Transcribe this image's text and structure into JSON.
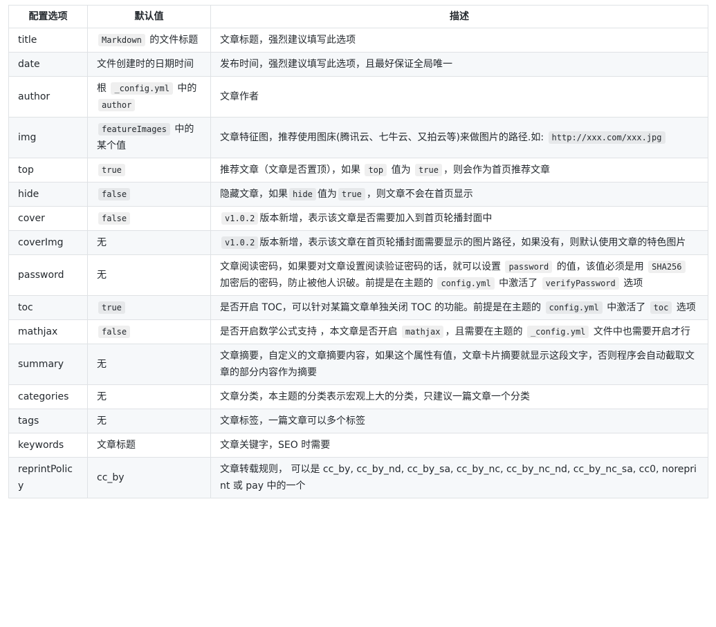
{
  "headers": [
    "配置选项",
    "默认值",
    "描述"
  ],
  "rows": [
    {
      "name": "title",
      "default": [
        {
          "code": "Markdown"
        },
        " 的文件标题"
      ],
      "desc": [
        "文章标题，强烈建议填写此选项"
      ]
    },
    {
      "name": "date",
      "default": [
        "文件创建时的日期时间"
      ],
      "desc": [
        "发布时间，强烈建议填写此选项，且最好保证全局唯一"
      ]
    },
    {
      "name": "author",
      "default": [
        "根 ",
        {
          "code": "_config.yml"
        },
        " 中的 ",
        {
          "code": "author"
        }
      ],
      "desc": [
        "文章作者"
      ]
    },
    {
      "name": "img",
      "default": [
        {
          "code": "featureImages"
        },
        " 中的某个值"
      ],
      "desc": [
        "文章特征图，推荐使用图床(腾讯云、七牛云、又拍云等)来做图片的路径.如: ",
        {
          "code": "http://xxx.com/xxx.jpg"
        }
      ]
    },
    {
      "name": "top",
      "default": [
        {
          "code": "true"
        }
      ],
      "desc": [
        "推荐文章（文章是否置顶），如果 ",
        {
          "code": "top"
        },
        " 值为 ",
        {
          "code": "true"
        },
        "，则会作为首页推荐文章"
      ]
    },
    {
      "name": "hide",
      "default": [
        {
          "code": "false"
        }
      ],
      "desc": [
        "隐藏文章，如果",
        {
          "code": "hide"
        },
        "值为",
        {
          "code": "true"
        },
        "，则文章不会在首页显示"
      ]
    },
    {
      "name": "cover",
      "default": [
        {
          "code": "false"
        }
      ],
      "desc": [
        {
          "code": "v1.0.2"
        },
        "版本新增，表示该文章是否需要加入到首页轮播封面中"
      ]
    },
    {
      "name": "coverImg",
      "default": [
        "无"
      ],
      "desc": [
        {
          "code": "v1.0.2"
        },
        "版本新增，表示该文章在首页轮播封面需要显示的图片路径，如果没有，则默认使用文章的特色图片"
      ]
    },
    {
      "name": "password",
      "default": [
        "无"
      ],
      "desc": [
        "文章阅读密码，如果要对文章设置阅读验证密码的话，就可以设置 ",
        {
          "code": "password"
        },
        " 的值，该值必须是用 ",
        {
          "code": "SHA256"
        },
        " 加密后的密码，防止被他人识破。前提是在主题的 ",
        {
          "code": "config.yml"
        },
        " 中激活了 ",
        {
          "code": "verifyPassword"
        },
        " 选项"
      ]
    },
    {
      "name": "toc",
      "default": [
        {
          "code": "true"
        }
      ],
      "desc": [
        "是否开启 TOC，可以针对某篇文章单独关闭 TOC 的功能。前提是在主题的 ",
        {
          "code": "config.yml"
        },
        " 中激活了 ",
        {
          "code": "toc"
        },
        " 选项"
      ]
    },
    {
      "name": "mathjax",
      "default": [
        {
          "code": "false"
        }
      ],
      "desc": [
        "是否开启数学公式支持 ，本文章是否开启 ",
        {
          "code": "mathjax"
        },
        "，且需要在主题的 ",
        {
          "code": "_config.yml"
        },
        " 文件中也需要开启才行"
      ]
    },
    {
      "name": "summary",
      "default": [
        "无"
      ],
      "desc": [
        "文章摘要，自定义的文章摘要内容，如果这个属性有值，文章卡片摘要就显示这段文字，否则程序会自动截取文章的部分内容作为摘要"
      ]
    },
    {
      "name": "categories",
      "default": [
        "无"
      ],
      "desc": [
        "文章分类，本主题的分类表示宏观上大的分类，只建议一篇文章一个分类"
      ]
    },
    {
      "name": "tags",
      "default": [
        "无"
      ],
      "desc": [
        "文章标签，一篇文章可以多个标签"
      ]
    },
    {
      "name": "keywords",
      "default": [
        "文章标题"
      ],
      "desc": [
        "文章关键字，SEO 时需要"
      ]
    },
    {
      "name": "reprintPolicy",
      "default": [
        "cc_by"
      ],
      "desc": [
        "文章转载规则， 可以是 cc_by, cc_by_nd, cc_by_sa, cc_by_nc, cc_by_nc_nd, cc_by_nc_sa, cc0, noreprint 或 pay 中的一个"
      ]
    }
  ]
}
